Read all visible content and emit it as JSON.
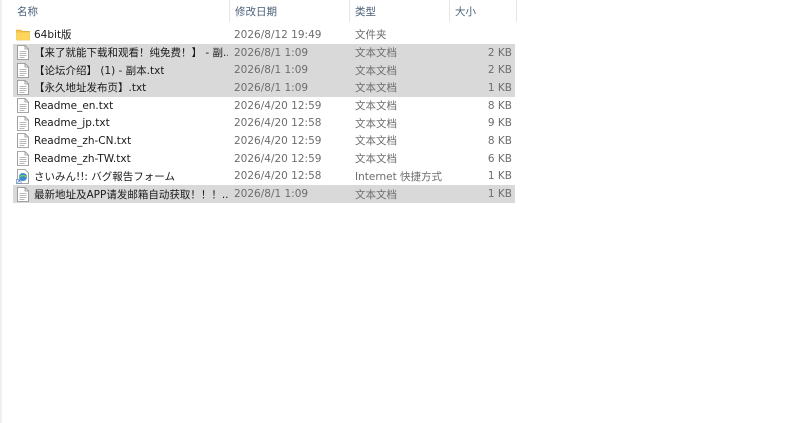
{
  "columns": {
    "name": "名称",
    "date": "修改日期",
    "type": "类型",
    "size": "大小",
    "sort_indicator": "^"
  },
  "rows": [
    {
      "name": "64bit版",
      "date": "2026/8/12 19:49",
      "type": "文件夹",
      "size": "",
      "icon": "folder-icon",
      "selected": false
    },
    {
      "name": "【来了就能下载和观看！纯免费！】 - 副...",
      "date": "2026/8/1 1:09",
      "type": "文本文档",
      "size": "2 KB",
      "icon": "text-file-icon",
      "selected": true
    },
    {
      "name": "【论坛介绍】 (1) - 副本.txt",
      "date": "2026/8/1 1:09",
      "type": "文本文档",
      "size": "2 KB",
      "icon": "text-file-icon",
      "selected": true
    },
    {
      "name": "【永久地址发布页】.txt",
      "date": "2026/8/1 1:09",
      "type": "文本文档",
      "size": "1 KB",
      "icon": "text-file-icon",
      "selected": true
    },
    {
      "name": "Readme_en.txt",
      "date": "2026/4/20 12:59",
      "type": "文本文档",
      "size": "8 KB",
      "icon": "text-file-icon",
      "selected": false
    },
    {
      "name": "Readme_jp.txt",
      "date": "2026/4/20 12:58",
      "type": "文本文档",
      "size": "9 KB",
      "icon": "text-file-icon",
      "selected": false
    },
    {
      "name": "Readme_zh-CN.txt",
      "date": "2026/4/20 12:59",
      "type": "文本文档",
      "size": "8 KB",
      "icon": "text-file-icon",
      "selected": false
    },
    {
      "name": "Readme_zh-TW.txt",
      "date": "2026/4/20 12:59",
      "type": "文本文档",
      "size": "6 KB",
      "icon": "text-file-icon",
      "selected": false
    },
    {
      "name": "さいみん!!: バグ報告フォーム",
      "date": "2026/4/20 12:58",
      "type": "Internet 快捷方式",
      "size": "1 KB",
      "icon": "internet-shortcut-icon",
      "selected": false
    },
    {
      "name": "最新地址及APP请发邮箱自动获取！！！...",
      "date": "2026/8/1 1:09",
      "type": "文本文档",
      "size": "1 KB",
      "icon": "text-file-icon",
      "selected": true
    }
  ]
}
